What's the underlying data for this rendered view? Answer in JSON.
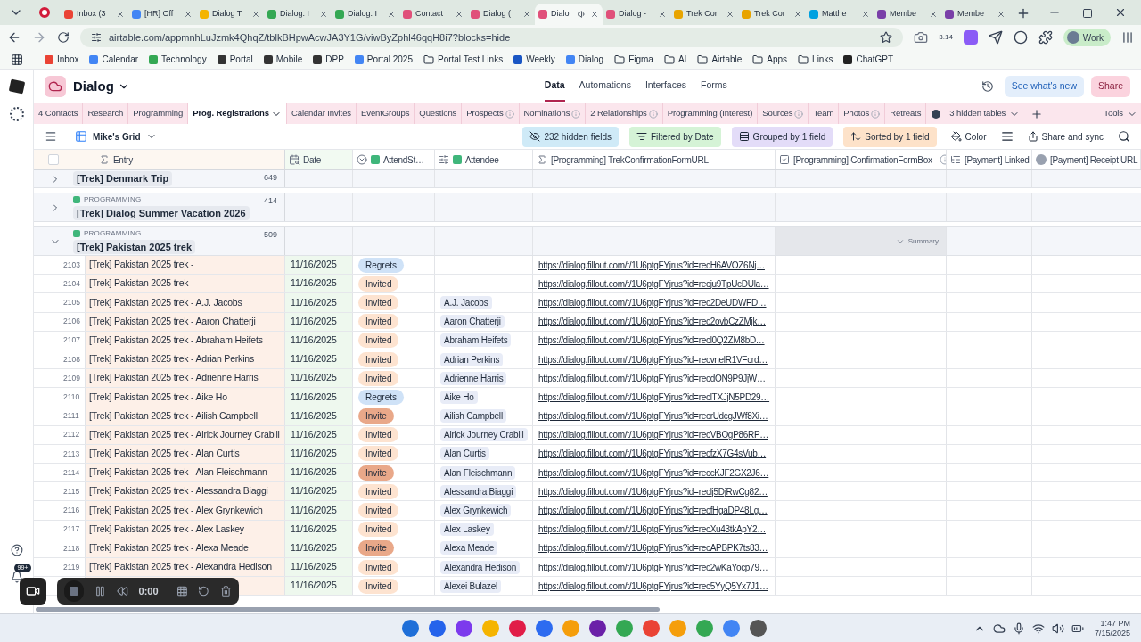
{
  "browser": {
    "tabs": [
      {
        "title": "Inbox (3",
        "color": "#ea4335",
        "selected": false,
        "audio": false
      },
      {
        "title": "[HR] Off",
        "color": "#4285f4",
        "selected": false,
        "audio": false
      },
      {
        "title": "Dialog T",
        "color": "#f4b400",
        "selected": false,
        "audio": false
      },
      {
        "title": "Dialog: I",
        "color": "#34a853",
        "selected": false,
        "audio": false
      },
      {
        "title": "Dialog: I",
        "color": "#34a853",
        "selected": false,
        "audio": false
      },
      {
        "title": "Contact",
        "color": "#e0507a",
        "selected": false,
        "audio": false
      },
      {
        "title": "Dialog (",
        "color": "#e0507a",
        "selected": false,
        "audio": false
      },
      {
        "title": "Dialo",
        "color": "#e0507a",
        "selected": true,
        "audio": true
      },
      {
        "title": "Dialog -",
        "color": "#e0507a",
        "selected": false,
        "audio": false
      },
      {
        "title": "Trek Cor",
        "color": "#e8a400",
        "selected": false,
        "audio": false
      },
      {
        "title": "Trek Cor",
        "color": "#e8a400",
        "selected": false,
        "audio": false
      },
      {
        "title": "Matthe",
        "color": "#00a1e0",
        "selected": false,
        "audio": false
      },
      {
        "title": "Membe",
        "color": "#7a3fa8",
        "selected": false,
        "audio": false
      },
      {
        "title": "Membe",
        "color": "#7a3fa8",
        "selected": false,
        "audio": false
      }
    ],
    "address": "airtable.com/appmnhLuJzmk4QhqZ/tblkBHpwAcwJA3Y1G/viwByZphl46qqH8i7?blocks=hide",
    "extension_badge": "3.14",
    "profile": "Work",
    "bookmarks": [
      {
        "label": "Inbox",
        "kind": "site",
        "color": "#ea4335"
      },
      {
        "label": "Calendar",
        "kind": "site",
        "color": "#4285f4"
      },
      {
        "label": "Technology",
        "kind": "site",
        "color": "#34a853"
      },
      {
        "label": "Portal",
        "kind": "site",
        "color": "#333333"
      },
      {
        "label": "Mobile",
        "kind": "site",
        "color": "#333333"
      },
      {
        "label": "DPP",
        "kind": "site",
        "color": "#333333"
      },
      {
        "label": "Portal 2025",
        "kind": "site",
        "color": "#4285f4"
      },
      {
        "label": "Portal Test Links",
        "kind": "folder"
      },
      {
        "label": "Weekly",
        "kind": "site",
        "color": "#1a56c4"
      },
      {
        "label": "Dialog",
        "kind": "site",
        "color": "#4285f4"
      },
      {
        "label": "Figma",
        "kind": "folder"
      },
      {
        "label": "AI",
        "kind": "folder"
      },
      {
        "label": "Airtable",
        "kind": "folder"
      },
      {
        "label": "Apps",
        "kind": "folder"
      },
      {
        "label": "Links",
        "kind": "folder"
      },
      {
        "label": "ChatGPT",
        "kind": "site",
        "color": "#222222"
      }
    ]
  },
  "app": {
    "base_name": "Dialog",
    "nav": [
      {
        "label": "Data",
        "selected": true
      },
      {
        "label": "Automations",
        "selected": false
      },
      {
        "label": "Interfaces",
        "selected": false
      },
      {
        "label": "Forms",
        "selected": false
      }
    ],
    "whats_new": "See what's new",
    "share": "Share"
  },
  "table_tabs": [
    {
      "label": "4 Contacts",
      "selected": false,
      "info": false
    },
    {
      "label": "Research",
      "selected": false,
      "info": false
    },
    {
      "label": "Programming",
      "selected": false,
      "info": false
    },
    {
      "label": "Prog. Registrations",
      "selected": true,
      "info": false
    },
    {
      "label": "Calendar Invites",
      "selected": false,
      "info": false
    },
    {
      "label": "EventGroups",
      "selected": false,
      "info": false
    },
    {
      "label": "Questions",
      "selected": false,
      "info": false
    },
    {
      "label": "Prospects",
      "selected": false,
      "info": true
    },
    {
      "label": "Nominations",
      "selected": false,
      "info": true
    },
    {
      "label": "2 Relationships",
      "selected": false,
      "info": true
    },
    {
      "label": "Programming (Interest)",
      "selected": false,
      "info": false
    },
    {
      "label": "Sources",
      "selected": false,
      "info": true
    },
    {
      "label": "Team",
      "selected": false,
      "info": false
    },
    {
      "label": "Photos",
      "selected": false,
      "info": true
    },
    {
      "label": "Retreats",
      "selected": false,
      "info": false
    }
  ],
  "hidden_tables": "3 hidden tables",
  "tools": "Tools",
  "view": {
    "name": "Mike's Grid",
    "chips": [
      {
        "label": "232 hidden fields",
        "kind": "hidden"
      },
      {
        "label": "Filtered by Date",
        "kind": "filter"
      },
      {
        "label": "Grouped by 1 field",
        "kind": "group"
      },
      {
        "label": "Sorted by 1 field",
        "kind": "sort"
      }
    ],
    "color_label": "Color",
    "share_sync": "Share and sync"
  },
  "select_all_checked": false,
  "columns": [
    {
      "label": "Entry",
      "kind": "formula",
      "info": false
    },
    {
      "label": "Date",
      "kind": "date",
      "info": false
    },
    {
      "label": "AttendSt…",
      "kind": "status_lookup",
      "info": false
    },
    {
      "label": "Attendee",
      "kind": "link_lookup",
      "info": false
    },
    {
      "label": "[Programming] TrekConfirmationFormURL",
      "kind": "formula",
      "info": false
    },
    {
      "label": "[Programming] ConfirmationFormBox",
      "kind": "checkbox",
      "info": true
    },
    {
      "label": "[Payment] Linked",
      "kind": "linked",
      "info": false
    },
    {
      "label": "[Payment] Receipt URL",
      "kind": "attachment",
      "info": false
    }
  ],
  "groups": [
    {
      "title": "[Trek] Denmark Trip",
      "count": "649",
      "expanded": false
    },
    {
      "category": "PROGRAMMING",
      "title": "[Trek] Dialog Summer Vacation 2026",
      "count": "414",
      "expanded": false
    },
    {
      "category": "PROGRAMMING",
      "title": "[Trek] Pakistan 2025 trek",
      "count": "509",
      "expanded": true,
      "summary": "Summary"
    }
  ],
  "rows": [
    {
      "number": "2103",
      "entry": "[Trek] Pakistan 2025 trek -",
      "date": "11/16/2025",
      "status": {
        "label": "Regrets",
        "color": "#cfe2f7"
      },
      "url": "https://dialog.fillout.com/t/1U6ptgFYjrus?id=recH6AVOZ6Nj…"
    },
    {
      "number": "2104",
      "entry": "[Trek] Pakistan 2025 trek -",
      "date": "11/16/2025",
      "status": {
        "label": "Invited",
        "color": "#fde3d0"
      },
      "url": "https://dialog.fillout.com/t/1U6ptgFYjrus?id=recju9TpUcDUla…"
    },
    {
      "number": "2105",
      "entry": "[Trek] Pakistan 2025 trek - A.J. Jacobs",
      "date": "11/16/2025",
      "status": {
        "label": "Invited",
        "color": "#fde3d0"
      },
      "attendee": "A.J. Jacobs",
      "url": "https://dialog.fillout.com/t/1U6ptgFYjrus?id=rec2DeUDWFD…"
    },
    {
      "number": "2106",
      "entry": "[Trek] Pakistan 2025 trek - Aaron Chatterji",
      "date": "11/16/2025",
      "status": {
        "label": "Invited",
        "color": "#fde3d0"
      },
      "attendee": "Aaron Chatterji",
      "url": "https://dialog.fillout.com/t/1U6ptgFYjrus?id=rec2ovbCzZMjk…"
    },
    {
      "number": "2107",
      "entry": "[Trek] Pakistan 2025 trek - Abraham Heifets",
      "date": "11/16/2025",
      "status": {
        "label": "Invited",
        "color": "#fde3d0"
      },
      "attendee": "Abraham Heifets",
      "url": "https://dialog.fillout.com/t/1U6ptgFYjrus?id=recl0Q2ZM8bD…"
    },
    {
      "number": "2108",
      "entry": "[Trek] Pakistan 2025 trek - Adrian Perkins",
      "date": "11/16/2025",
      "status": {
        "label": "Invited",
        "color": "#fde3d0"
      },
      "attendee": "Adrian Perkins",
      "url": "https://dialog.fillout.com/t/1U6ptgFYjrus?id=recvnelR1VFcrd…"
    },
    {
      "number": "2109",
      "entry": "[Trek] Pakistan 2025 trek - Adrienne Harris",
      "date": "11/16/2025",
      "status": {
        "label": "Invited",
        "color": "#fde3d0"
      },
      "attendee": "Adrienne Harris",
      "url": "https://dialog.fillout.com/t/1U6ptgFYjrus?id=recdON9P9JjW…"
    },
    {
      "number": "2110",
      "entry": "[Trek] Pakistan 2025 trek - Aike Ho",
      "date": "11/16/2025",
      "status": {
        "label": "Regrets",
        "color": "#cfe2f7"
      },
      "attendee": "Aike Ho",
      "url": "https://dialog.fillout.com/t/1U6ptgFYjrus?id=reclTXJjN5PD29…"
    },
    {
      "number": "2111",
      "entry": "[Trek] Pakistan 2025 trek - Ailish Campbell",
      "date": "11/16/2025",
      "status": {
        "label": "Invite",
        "color": "#e9a889"
      },
      "attendee": "Ailish Campbell",
      "url": "https://dialog.fillout.com/t/1U6ptgFYjrus?id=recrUdcgJWf8Xi…"
    },
    {
      "number": "2112",
      "entry": "[Trek] Pakistan 2025 trek - Airick Journey Crabill",
      "date": "11/16/2025",
      "status": {
        "label": "Invited",
        "color": "#fde3d0"
      },
      "attendee": "Airick Journey Crabill",
      "url": "https://dialog.fillout.com/t/1U6ptgFYjrus?id=recVBOgP86RP…"
    },
    {
      "number": "2113",
      "entry": "[Trek] Pakistan 2025 trek - Alan Curtis",
      "date": "11/16/2025",
      "status": {
        "label": "Invited",
        "color": "#fde3d0"
      },
      "attendee": "Alan Curtis",
      "url": "https://dialog.fillout.com/t/1U6ptgFYjrus?id=recfzX7G4sVub…"
    },
    {
      "number": "2114",
      "entry": "[Trek] Pakistan 2025 trek - Alan Fleischmann",
      "date": "11/16/2025",
      "status": {
        "label": "Invite",
        "color": "#e9a889"
      },
      "attendee": "Alan Fleischmann",
      "url": "https://dialog.fillout.com/t/1U6ptgFYjrus?id=reccKJF2GX2J6…"
    },
    {
      "number": "2115",
      "entry": "[Trek] Pakistan 2025 trek - Alessandra Biaggi",
      "date": "11/16/2025",
      "status": {
        "label": "Invited",
        "color": "#fde3d0"
      },
      "attendee": "Alessandra Biaggi",
      "url": "https://dialog.fillout.com/t/1U6ptgFYjrus?id=reclj5DjRwCg82…"
    },
    {
      "number": "2116",
      "entry": "[Trek] Pakistan 2025 trek - Alex Grynkewich",
      "date": "11/16/2025",
      "status": {
        "label": "Invited",
        "color": "#fde3d0"
      },
      "attendee": "Alex Grynkewich",
      "url": "https://dialog.fillout.com/t/1U6ptgFYjrus?id=recfHgaDP48Lg…"
    },
    {
      "number": "2117",
      "entry": "[Trek] Pakistan 2025 trek - Alex Laskey",
      "date": "11/16/2025",
      "status": {
        "label": "Invited",
        "color": "#fde3d0"
      },
      "attendee": "Alex Laskey",
      "url": "https://dialog.fillout.com/t/1U6ptgFYjrus?id=recXu43tkApY2…"
    },
    {
      "number": "2118",
      "entry": "[Trek] Pakistan 2025 trek - Alexa Meade",
      "date": "11/16/2025",
      "status": {
        "label": "Invite",
        "color": "#e9a889"
      },
      "attendee": "Alexa Meade",
      "url": "https://dialog.fillout.com/t/1U6ptgFYjrus?id=recAPBPK7ts83…"
    },
    {
      "number": "2119",
      "entry": "[Trek] Pakistan 2025 trek - Alexandra Hedison",
      "date": "11/16/2025",
      "status": {
        "label": "Invited",
        "color": "#fde3d0"
      },
      "attendee": "Alexandra Hedison",
      "url": "https://dialog.fillout.com/t/1U6ptgFYjrus?id=rec2wKaYocp79…"
    },
    {
      "date": "11/16/2025",
      "status": {
        "label": "Invited",
        "color": "#fde3d0"
      },
      "attendee": "Alexei Bulazel",
      "url": "https://dialog.fillout.com/t/1U6ptgFYjrus?id=rec5YyQ5Yx7J1…"
    }
  ],
  "notifications": "99+",
  "recorder": {
    "time": "0:00"
  },
  "clock": {
    "time": "1:47 PM",
    "date": "7/15/2025"
  }
}
